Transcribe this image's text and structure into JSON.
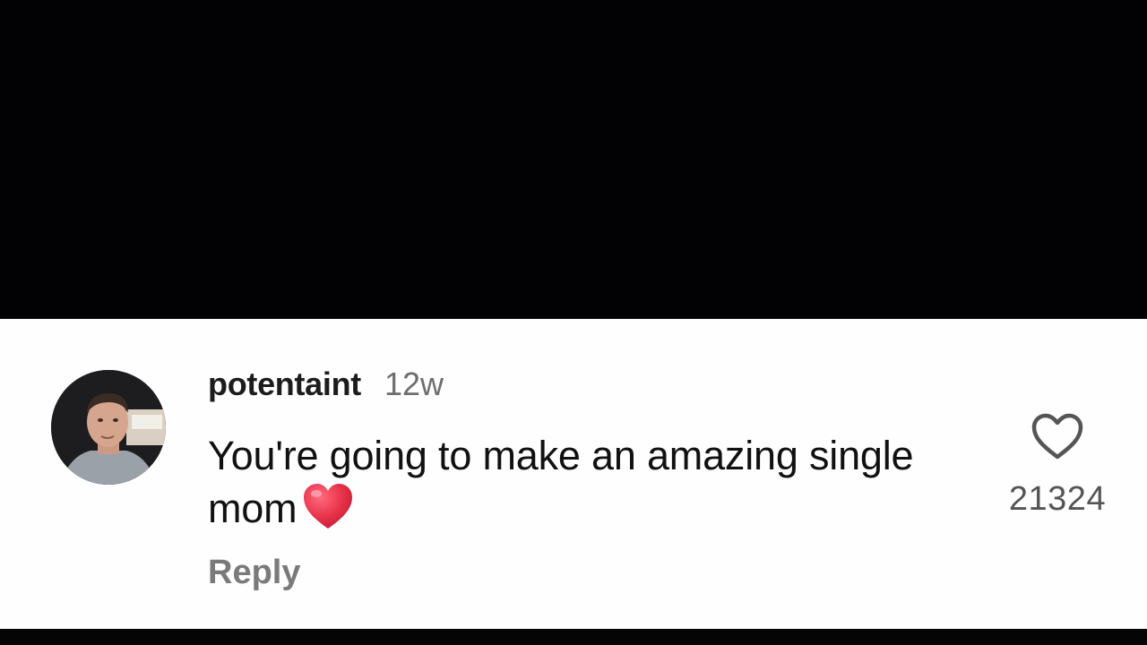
{
  "comment": {
    "username": "potentaint",
    "timestamp": "12w",
    "text": "You're going to make an amazing single mom",
    "emoji": "red-heart-emoji",
    "reply_label": "Reply",
    "like_count": "21324",
    "like_icon": "heart-outline-icon"
  },
  "colors": {
    "video_background": "#020204",
    "card_background": "#fefefe",
    "username": "#1c1c1c",
    "secondary_text": "#7a7a7a",
    "heart_emoji": "#e8334a"
  }
}
